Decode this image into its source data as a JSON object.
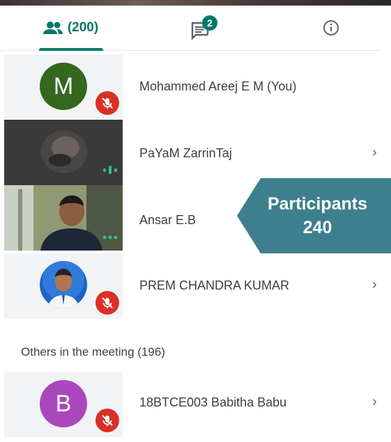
{
  "tabs": {
    "people_count": "(200)",
    "chat_badge": "2"
  },
  "participants": [
    {
      "initial": "M",
      "name": "Mohammed Areej E M (You)",
      "avatar_color": "#33691e",
      "muted": true
    },
    {
      "name": "PaYaM ZarrinTaj",
      "state": "speaking"
    },
    {
      "name": "Ansar E.B",
      "state": "more"
    },
    {
      "name": "PREM CHANDRA KUMAR",
      "muted": true
    }
  ],
  "others": {
    "label": "Others in the meeting (196)",
    "items": [
      {
        "initial": "B",
        "name": "18BTCE003 Babitha Babu",
        "avatar_color": "#ab47bc",
        "muted": true
      }
    ]
  },
  "callout": {
    "line1": "Participants",
    "line2": "240",
    "color": "#3d7f8e"
  },
  "colors": {
    "accent": "#00796b",
    "mute_red": "#d93025"
  }
}
